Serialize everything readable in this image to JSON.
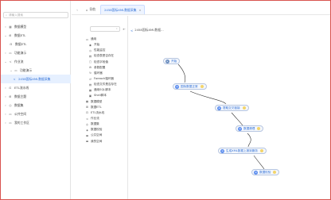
{
  "left_nav": {
    "search_placeholder": "请输入搜索",
    "items": [
      {
        "label": "数据模型",
        "icon": "table-icon"
      },
      {
        "label": "数据ETL",
        "icon": "etl-icon"
      },
      {
        "label": "数据ETL",
        "icon": "etl-icon"
      },
      {
        "label": "功能演示",
        "icon": "folder-icon"
      },
      {
        "label": "作业流",
        "icon": "workflow-icon"
      },
      {
        "label": "功能演示",
        "icon": "folder-icon"
      },
      {
        "label": "2458国标XML数据采集",
        "icon": "flow-icon"
      },
      {
        "label": "ETL流水线",
        "icon": "pipeline-icon"
      },
      {
        "label": "数据主题",
        "icon": "topic-icon"
      },
      {
        "label": "数据集",
        "icon": "dataset-icon"
      },
      {
        "label": "公共空间",
        "icon": "public-icon"
      },
      {
        "label": "我的工作区",
        "icon": "workspace-icon"
      }
    ]
  },
  "tabs": {
    "home_label": "导航",
    "active_label": "2458国标XML数据采集",
    "close_glyph": "×"
  },
  "palette": {
    "items": [
      {
        "label": "通用",
        "icon": "folder-icon",
        "sub": false
      },
      {
        "label": "开始",
        "icon": "start-icon",
        "sub": true
      },
      {
        "label": "性能监控",
        "icon": "monitor-icon",
        "sub": true
      },
      {
        "label": "检查表是否存在",
        "icon": "table-check-icon",
        "sub": true
      },
      {
        "label": "检查字段值",
        "icon": "field-check-icon",
        "sub": true
      },
      {
        "label": "参数配置",
        "icon": "param-icon",
        "sub": true
      },
      {
        "label": "循环器",
        "icon": "loop-icon",
        "sub": true
      },
      {
        "label": "Foreach循环器",
        "icon": "foreach-icon",
        "sub": true
      },
      {
        "label": "检查文件是否存在",
        "icon": "file-check-icon",
        "sub": true
      },
      {
        "label": "通用SQL脚本",
        "icon": "sql-icon",
        "sub": true
      },
      {
        "label": "Shell脚本",
        "icon": "shell-icon",
        "sub": true
      },
      {
        "label": "数据模型",
        "icon": "model-icon",
        "sub": false
      },
      {
        "label": "数据ETL",
        "icon": "etl-icon",
        "sub": false
      },
      {
        "label": "ETL流水线",
        "icon": "pipeline-icon",
        "sub": false
      },
      {
        "label": "作业流",
        "icon": "workflow-icon",
        "sub": false
      },
      {
        "label": "数据集",
        "icon": "dataset-icon",
        "sub": false
      },
      {
        "label": "数据校验",
        "icon": "validate-icon",
        "sub": false
      },
      {
        "label": "公共空间",
        "icon": "public-icon",
        "sub": false
      },
      {
        "label": "我的空间",
        "icon": "myspace-icon",
        "sub": false
      }
    ]
  },
  "canvas": {
    "title": "2458国标XML数据...",
    "nodes": [
      {
        "label": "开始",
        "kind": "start"
      },
      {
        "label": "国标数据正常",
        "kind": "task"
      },
      {
        "label": "提取交叉链接",
        "kind": "task"
      },
      {
        "label": "数据清理",
        "kind": "task"
      },
      {
        "label": "生成XML数据上报到服务",
        "kind": "task"
      },
      {
        "label": "数据校验",
        "kind": "task"
      }
    ]
  },
  "colors": {
    "accent": "#2f6fd6",
    "frame_border": "#d9534f",
    "node_state": "#f3d56b"
  }
}
